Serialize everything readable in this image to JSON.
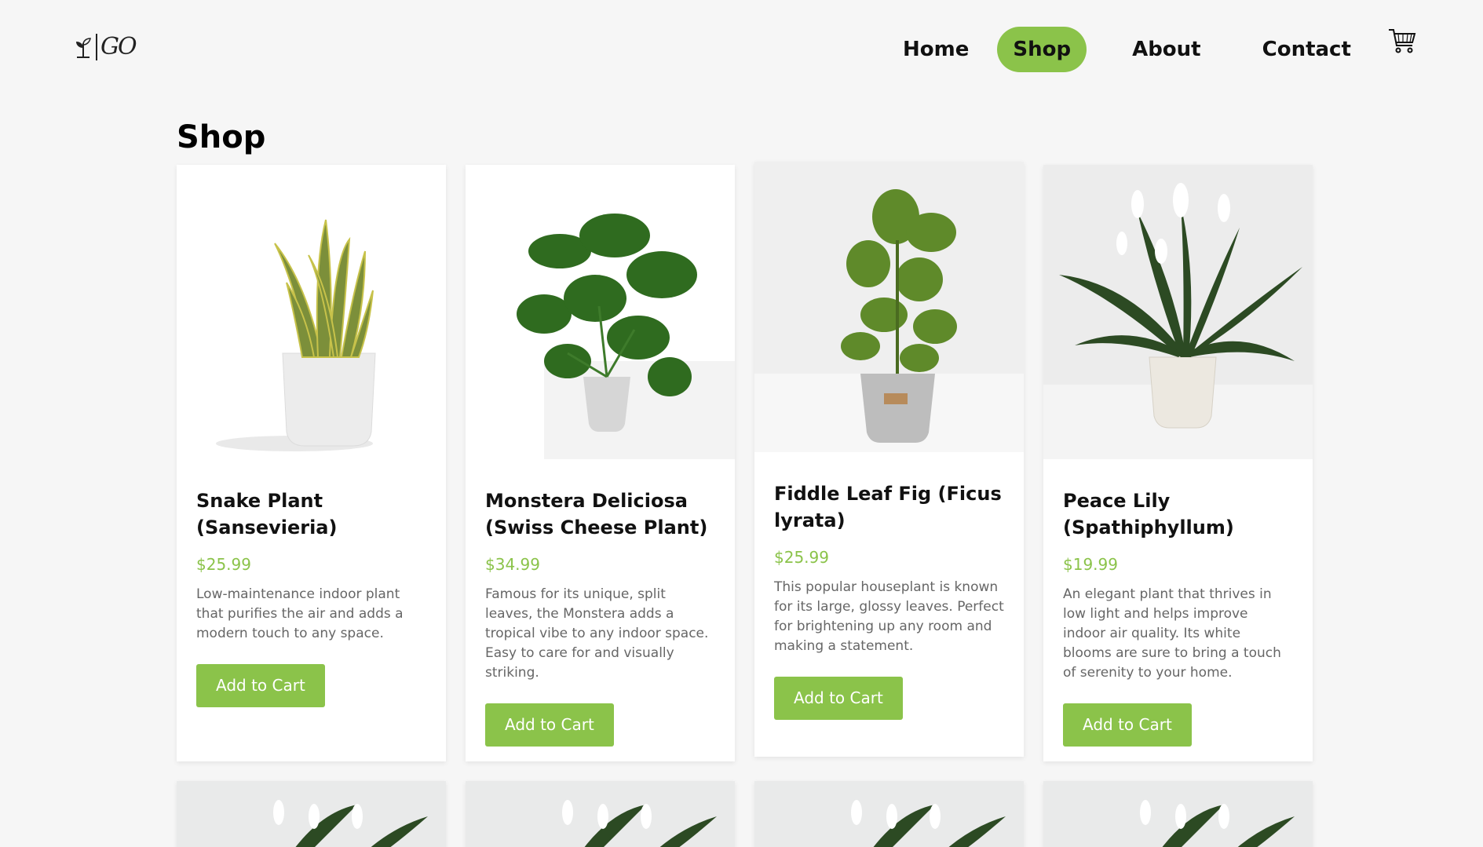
{
  "header": {
    "logo_text": "GO",
    "nav": [
      {
        "label": "Home",
        "active": false
      },
      {
        "label": "Shop",
        "active": true
      },
      {
        "label": "About",
        "active": false
      },
      {
        "label": "Contact",
        "active": false
      }
    ],
    "cart_icon": "cart-icon"
  },
  "page": {
    "title": "Shop"
  },
  "colors": {
    "accent": "#8bc34a",
    "background": "#f6f6f6"
  },
  "products": [
    {
      "name": "Snake Plant (Sansevieria)",
      "price": "$25.99",
      "description": "Low-maintenance indoor plant that purifies the air and adds a modern touch to any space.",
      "button": "Add to Cart"
    },
    {
      "name": "Monstera Deliciosa (Swiss Cheese Plant)",
      "price": "$34.99",
      "description": "Famous for its unique, split leaves, the Monstera adds a tropical vibe to any indoor space. Easy to care for and visually striking.",
      "button": "Add to Cart"
    },
    {
      "name": "Fiddle Leaf Fig (Ficus lyrata)",
      "price": "$25.99",
      "description": "This popular houseplant is known for its large, glossy leaves. Perfect for brightening up any room and making a statement.",
      "button": "Add to Cart"
    },
    {
      "name": "Peace Lily (Spathiphyllum)",
      "price": "$19.99",
      "description": "An elegant plant that thrives in low light and helps improve indoor air quality. Its white blooms are sure to bring a touch of serenity to your home.",
      "button": "Add to Cart"
    }
  ]
}
